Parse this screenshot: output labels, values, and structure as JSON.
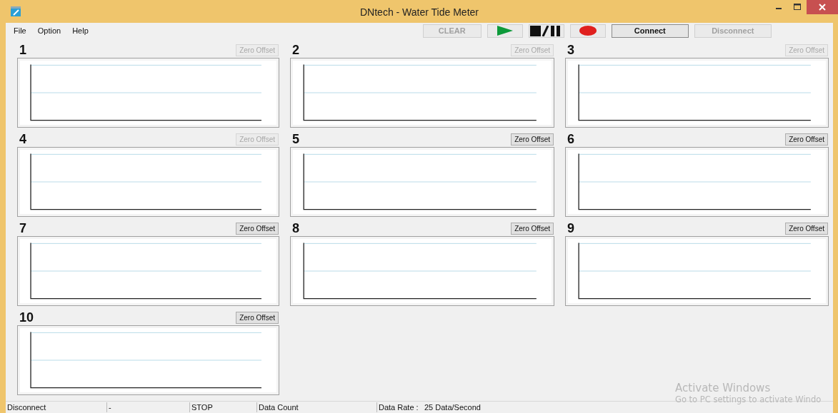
{
  "window": {
    "title": "DNtech - Water Tide Meter"
  },
  "menu": [
    "File",
    "Option",
    "Help"
  ],
  "toolbar": [
    {
      "kind": "text",
      "label": "CLEAR",
      "disabled": true
    },
    {
      "kind": "play"
    },
    {
      "kind": "stop_pause"
    },
    {
      "kind": "record"
    },
    {
      "kind": "text",
      "label": "Connect",
      "disabled": false
    },
    {
      "kind": "text",
      "label": "Disconnect",
      "disabled": true
    }
  ],
  "channels": [
    {
      "number": "1",
      "button": "Zero Offset",
      "disabled": true
    },
    {
      "number": "2",
      "button": "Zero Offset",
      "disabled": true
    },
    {
      "number": "3",
      "button": "Zero Offset",
      "disabled": true
    },
    {
      "number": "4",
      "button": "Zero Offset",
      "disabled": true
    },
    {
      "number": "5",
      "button": "Zero Offset",
      "disabled": false
    },
    {
      "number": "6",
      "button": "Zero Offset",
      "disabled": false
    },
    {
      "number": "7",
      "button": "Zero Offset",
      "disabled": false
    },
    {
      "number": "8",
      "button": "Zero Offset",
      "disabled": false
    },
    {
      "number": "9",
      "button": "Zero Offset",
      "disabled": false
    },
    {
      "number": "10",
      "button": "Zero Offset",
      "disabled": false
    }
  ],
  "status_bar": {
    "connection": "Disconnect",
    "field_2": "-",
    "state": "STOP",
    "count_label": "Data Count",
    "rate_label": "Data Rate :",
    "rate_value": "25 Data/Second"
  },
  "os_notice": {
    "title": "Activate Windows",
    "text": "Go to PC settings to activate Windo"
  }
}
